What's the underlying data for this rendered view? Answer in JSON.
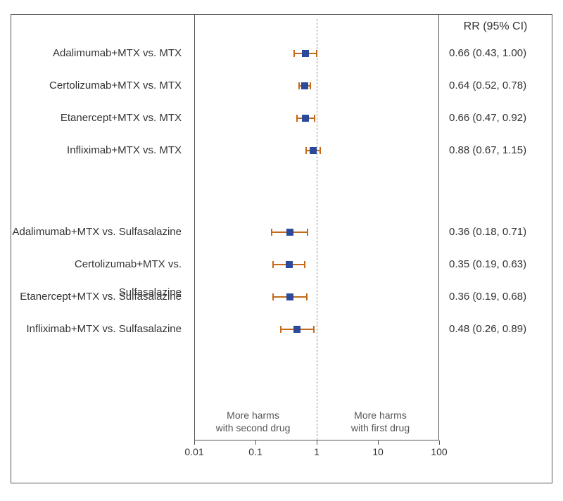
{
  "chart_data": {
    "type": "forest",
    "header": "RR (95% CI)",
    "xscale": "log",
    "xlim": [
      0.01,
      100
    ],
    "xticks": [
      0.01,
      0.1,
      1,
      10,
      100
    ],
    "xtick_labels": [
      "0.01",
      "0.1",
      "1",
      "10",
      "100"
    ],
    "refline": 1,
    "direction_left": "More harms\nwith second drug",
    "direction_right": "More harms\nwith first drug",
    "groups": [
      {
        "rows": [
          {
            "label": "Adalimumab+MTX vs. MTX",
            "rr": 0.66,
            "lo": 0.43,
            "hi": 1.0,
            "text": "0.66 (0.43, 1.00)"
          },
          {
            "label": "Certolizumab+MTX vs. MTX",
            "rr": 0.64,
            "lo": 0.52,
            "hi": 0.78,
            "text": "0.64 (0.52, 0.78)"
          },
          {
            "label": "Etanercept+MTX vs. MTX",
            "rr": 0.66,
            "lo": 0.47,
            "hi": 0.92,
            "text": "0.66 (0.47, 0.92)"
          },
          {
            "label": "Infliximab+MTX vs. MTX",
            "rr": 0.88,
            "lo": 0.67,
            "hi": 1.15,
            "text": "0.88 (0.67, 1.15)"
          }
        ]
      },
      {
        "rows": [
          {
            "label": "Adalimumab+MTX vs. Sulfasalazine",
            "rr": 0.36,
            "lo": 0.18,
            "hi": 0.71,
            "text": "0.36 (0.18, 0.71)"
          },
          {
            "label": "Certolizumab+MTX vs. Sulfasalazine",
            "rr": 0.35,
            "lo": 0.19,
            "hi": 0.63,
            "text": "0.35 (0.19, 0.63)"
          },
          {
            "label": "Etanercept+MTX vs. Sulfasalazine",
            "rr": 0.36,
            "lo": 0.19,
            "hi": 0.68,
            "text": "0.36 (0.19, 0.68)"
          },
          {
            "label": "Infliximab+MTX vs. Sulfasalazine",
            "rr": 0.48,
            "lo": 0.26,
            "hi": 0.89,
            "text": "0.48 (0.26, 0.89)"
          }
        ]
      }
    ]
  }
}
